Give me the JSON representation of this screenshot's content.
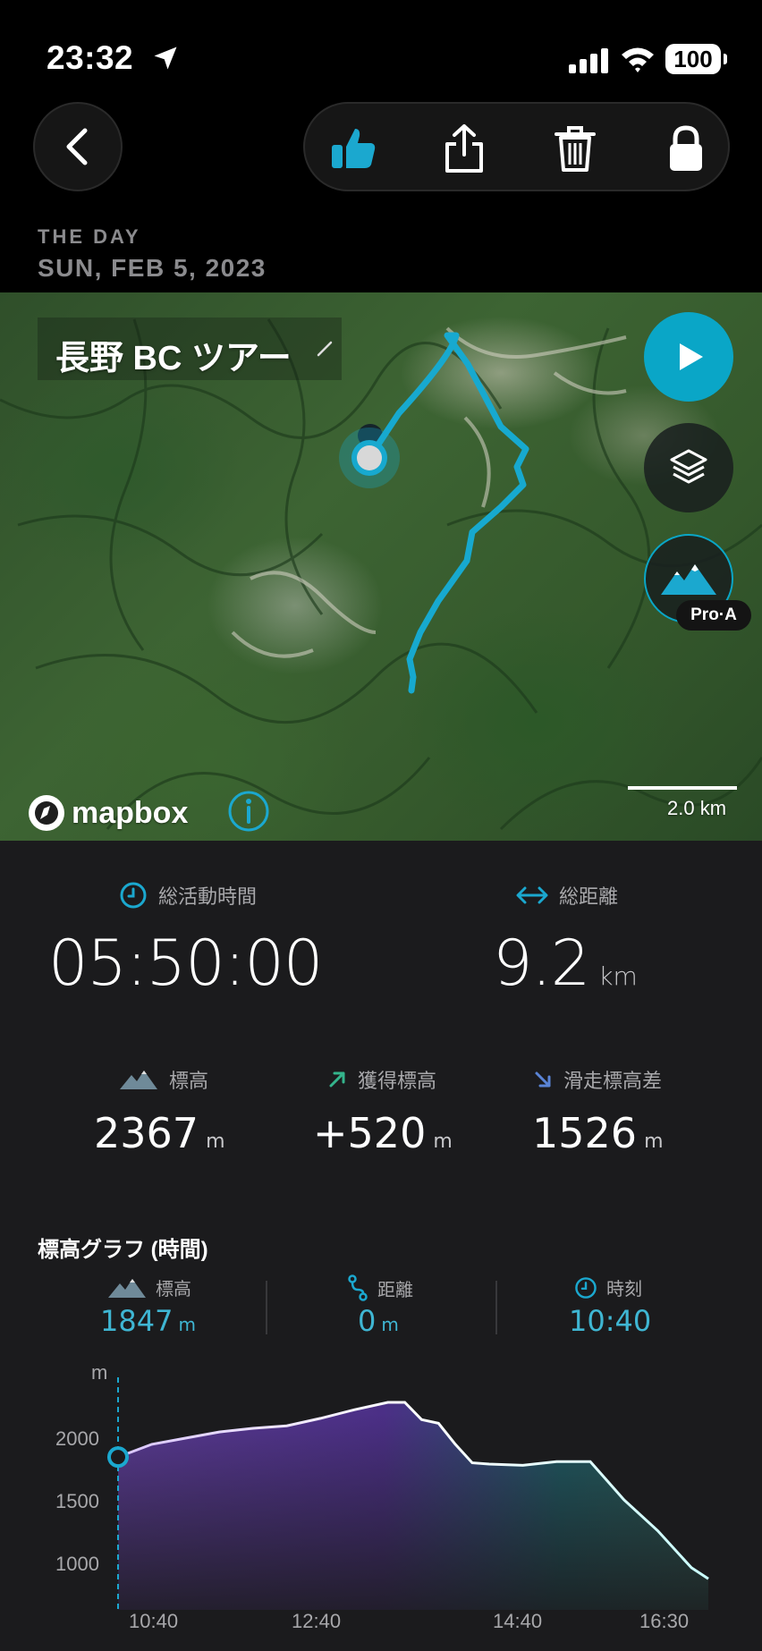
{
  "status_bar": {
    "time": "23:32",
    "battery": "100"
  },
  "header": {
    "day_label": "THE DAY",
    "date": "SUN, FEB 5, 2023"
  },
  "map": {
    "route_name": "長野 BC ツアー",
    "attribution": "mapbox",
    "scale": "2.0 km",
    "terrain_badge": "Pro·A",
    "route_color": "#17a9cf"
  },
  "stats": {
    "total_time": {
      "label": "総活動時間",
      "value": "05:50:00"
    },
    "total_distance": {
      "label": "総距離",
      "value": "9.2",
      "unit": "km"
    },
    "altitude": {
      "label": "標高",
      "value": "2367",
      "unit": "m"
    },
    "ascent": {
      "label": "獲得標高",
      "value": "+520",
      "unit": "m"
    },
    "descent": {
      "label": "滑走標高差",
      "value": "1526",
      "unit": "m"
    }
  },
  "graph": {
    "title": "標高グラフ (時間)",
    "readouts": [
      {
        "label": "標高",
        "value": "1847",
        "unit": "m"
      },
      {
        "label": "距離",
        "value": "0",
        "unit": "m"
      },
      {
        "label": "時刻",
        "value": "10:40",
        "unit": ""
      }
    ],
    "y_unit": "m",
    "y_ticks": [
      "2000",
      "1500",
      "1000"
    ],
    "x_ticks": [
      "10:40",
      "12:40",
      "14:40",
      "16:30"
    ]
  },
  "chart_data": {
    "type": "area",
    "xlabel": "",
    "ylabel": "m",
    "ylim": [
      800,
      2500
    ],
    "x": [
      "10:40",
      "11:00",
      "11:20",
      "11:40",
      "12:00",
      "12:20",
      "12:40",
      "13:00",
      "13:20",
      "13:30",
      "13:40",
      "13:50",
      "14:00",
      "14:10",
      "14:20",
      "14:40",
      "15:00",
      "15:20",
      "15:40",
      "16:00",
      "16:20",
      "16:30"
    ],
    "series": [
      {
        "values": [
          1847,
          1950,
          2000,
          2050,
          2080,
          2100,
          2160,
          2230,
          2290,
          2290,
          2150,
          2120,
          1950,
          1800,
          1790,
          1780,
          1810,
          1810,
          1500,
          1250,
          950,
          860
        ]
      }
    ]
  }
}
